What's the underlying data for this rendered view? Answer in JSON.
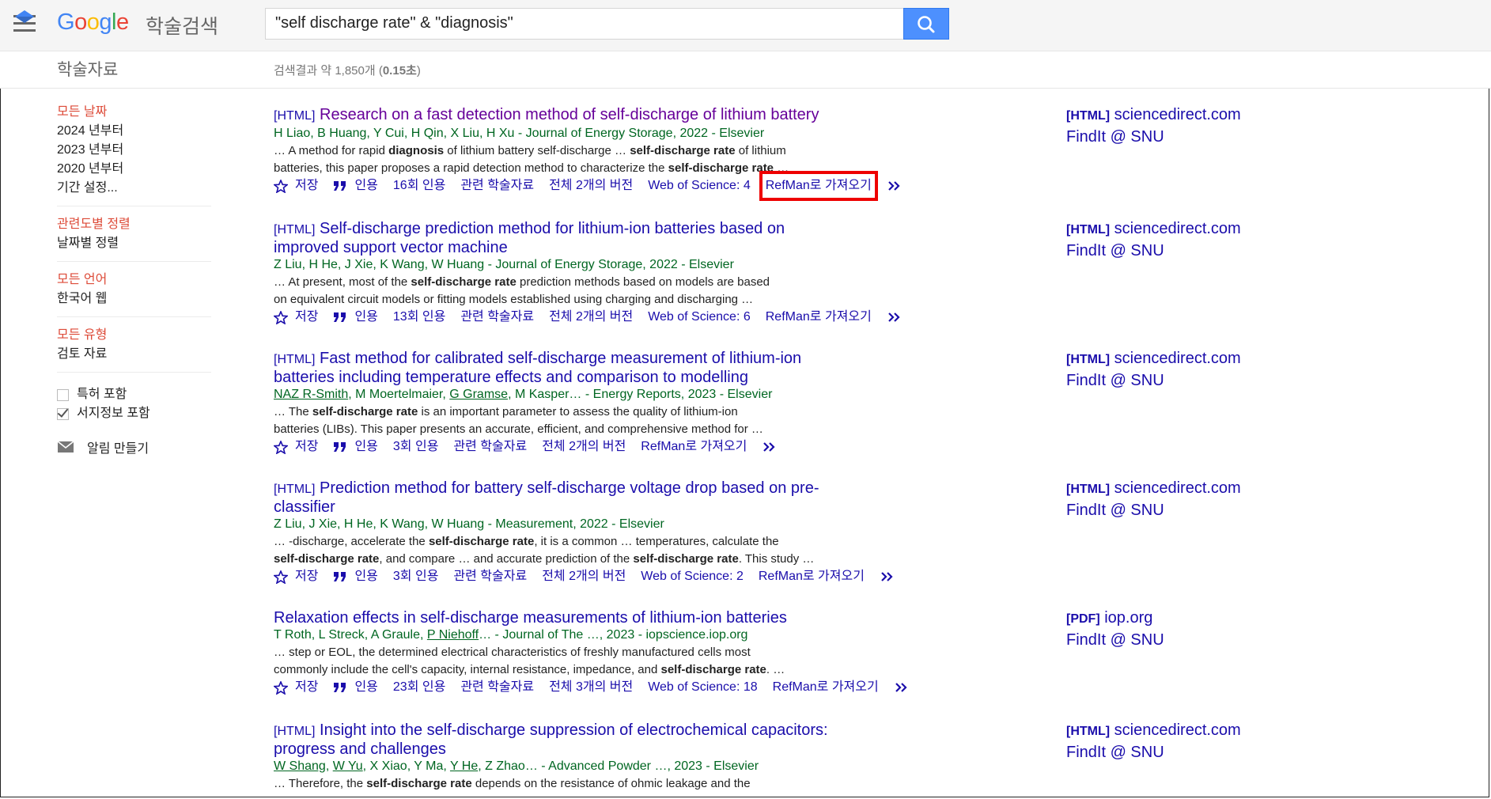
{
  "header": {
    "logo": {
      "g1": "G",
      "o1": "o",
      "o2": "o",
      "g2": "g",
      "l": "l",
      "e": "e"
    },
    "logo_suffix": "학술검색",
    "search_value": "\"self discharge rate\" & \"diagnosis\""
  },
  "subheader": {
    "section_title": "학술자료",
    "stats_prefix": "검색결과 약 1,850개 (",
    "stats_time": "0.15초",
    "stats_suffix": ")"
  },
  "sidebar": {
    "date": {
      "head": "모든 날짜",
      "items": [
        "2024 년부터",
        "2023 년부터",
        "2020 년부터",
        "기간 설정..."
      ]
    },
    "sort": {
      "head": "관련도별 정렬",
      "items": [
        "날짜별 정렬"
      ]
    },
    "lang": {
      "head": "모든 언어",
      "items": [
        "한국어 웹"
      ]
    },
    "type": {
      "head": "모든 유형",
      "items": [
        "검토 자료"
      ]
    },
    "patents": "특허 포함",
    "citations": "서지정보 포함",
    "alert": "알림 만들기"
  },
  "labels": {
    "save": "저장",
    "cite": "인용",
    "related": "관련 학술자료",
    "refman": "RefMan로 가져오기",
    "findit": "FindIt @ SNU"
  },
  "results": [
    {
      "tag": "[HTML]",
      "title": "Research on a fast detection method of self-discharge of lithium battery",
      "meta": "H Liao, B Huang, Y Cui, H Qin, X Liu, H Xu - Journal of Energy Storage, 2022 - Elsevier",
      "snip1a": "… A method for rapid ",
      "snip1b": "diagnosis",
      "snip1c": " of lithium battery self-discharge … ",
      "snip1d": "self-discharge rate",
      "snip1e": " of lithium",
      "snip2a": "batteries, this paper proposes a rapid detection method to characterize the ",
      "snip2b": "self-discharge rate",
      "snip2c": " …",
      "cited": "16회 인용",
      "versions": "전체 2개의 버전",
      "wos": "Web of Science: 4",
      "side_fmt": "[HTML]",
      "side_site": "sciencedirect.com"
    },
    {
      "tag": "[HTML]",
      "title": "Self-discharge prediction method for lithium-ion batteries based on",
      "title2": "improved support vector machine",
      "meta": "Z Liu, H He, J Xie, K Wang, W Huang - Journal of Energy Storage, 2022 - Elsevier",
      "snip1a": "… At present, most of the ",
      "snip1b": "self-discharge rate",
      "snip1c": " prediction methods based on models are based",
      "snip2a": "on equivalent circuit models or fitting models established using charging and discharging …",
      "cited": "13회 인용",
      "versions": "전체 2개의 버전",
      "wos": "Web of Science: 6",
      "side_fmt": "[HTML]",
      "side_site": "sciencedirect.com"
    },
    {
      "tag": "[HTML]",
      "title": "Fast method for calibrated self-discharge measurement of lithium-ion",
      "title2": "batteries including temperature effects and comparison to modelling",
      "meta_a": "NAZ R-Smith",
      "meta_b": ", M Moertelmaier, ",
      "meta_c": "G Gramse",
      "meta_d": ", M Kasper… - Energy Reports, 2023 - Elsevier",
      "snip1a": "… The ",
      "snip1b": "self-discharge rate",
      "snip1c": " is an important parameter to assess the quality of lithium-ion",
      "snip2a": "batteries (LIBs). This paper presents an accurate, efficient, and comprehensive method for …",
      "cited": "3회 인용",
      "versions": "전체 2개의 버전",
      "side_fmt": "[HTML]",
      "side_site": "sciencedirect.com"
    },
    {
      "tag": "[HTML]",
      "title": "Prediction method for battery self-discharge voltage drop based on pre-",
      "title2": "classifier",
      "meta": "Z Liu, J Xie, H He, K Wang, W Huang - Measurement, 2022 - Elsevier",
      "snip1a": "… -discharge, accelerate the ",
      "snip1b": "self-discharge rate",
      "snip1c": ", it is a common … temperatures, calculate the",
      "snip2a": "",
      "snip2b": "self-discharge rate",
      "snip2c": ", and compare … and accurate prediction of the ",
      "snip2d": "self-discharge rate",
      "snip2e": ". This study …",
      "cited": "3회 인용",
      "versions": "전체 2개의 버전",
      "wos": "Web of Science: 2",
      "side_fmt": "[HTML]",
      "side_site": "sciencedirect.com"
    },
    {
      "title": "Relaxation effects in self-discharge measurements of lithium-ion batteries",
      "meta_a": "T Roth, L Streck, A Graule, ",
      "meta_b": "P Niehoff",
      "meta_c": "… - Journal of The …, 2023 - iopscience.iop.org",
      "snip1a": "… step or EOL, the determined electrical characteristics of freshly manufactured cells most",
      "snip2a": "commonly include the cell's capacity, internal resistance, impedance, and ",
      "snip2b": "self-discharge rate",
      "snip2c": ". …",
      "cited": "23회 인용",
      "versions": "전체 3개의 버전",
      "wos": "Web of Science: 18",
      "side_fmt": "[PDF]",
      "side_site": "iop.org"
    },
    {
      "tag": "[HTML]",
      "title": "Insight into the self-discharge suppression of electrochemical capacitors:",
      "title2": "progress and challenges",
      "meta_a": "W Shang",
      "meta_b": ", ",
      "meta_c": "W Yu",
      "meta_d": ", X Xiao, Y Ma, ",
      "meta_e": "Y He",
      "meta_f": ", Z Zhao… - Advanced Powder …, 2023 - Elsevier",
      "snip1a": "… Therefore, the ",
      "snip1b": "self-discharge rate",
      "snip1c": " depends on the resistance of ohmic leakage and the",
      "side_fmt": "[HTML]",
      "side_site": "sciencedirect.com"
    }
  ]
}
